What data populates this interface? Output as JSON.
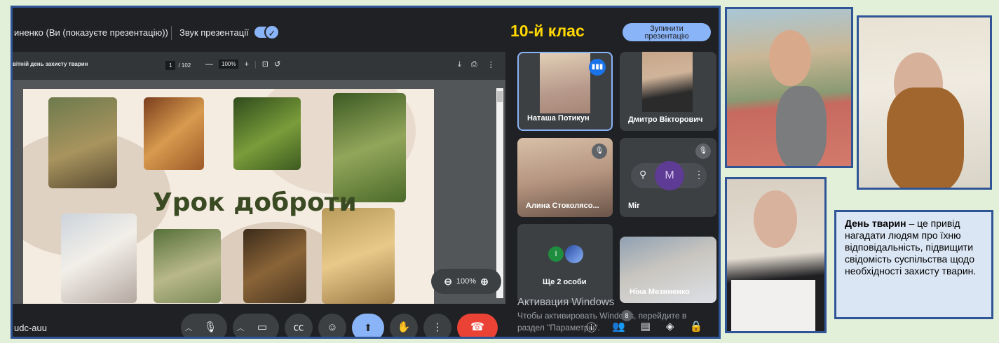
{
  "meet": {
    "presenter_text": "иненко (Ви (показуєте презентацію))",
    "sound_label": "Звук презентації",
    "class_label": "10-й клас",
    "stop_button": "Зупинити\nпрезентацію",
    "pdf": {
      "title": "вітній день захисту тварин",
      "page_current": "1",
      "page_total": "/ 102",
      "zoom": "100%",
      "slide_title": "Урок доброти",
      "zoom_pill": "100%"
    },
    "participants": [
      {
        "name": "Наташа Потикун",
        "speaking": true
      },
      {
        "name": "Дмитро Вікторович"
      },
      {
        "name": "Алина Стоколясо...",
        "muted": true
      },
      {
        "name": "Mir",
        "muted": true,
        "avatar_letter": "M"
      },
      {
        "name": "Ще 2 особи",
        "avatar_letter": "I"
      },
      {
        "name": "Ніна Мезиненко"
      }
    ],
    "meeting_code": "udc-auu",
    "activation_title": "Активация Windows",
    "activation_text": "Чтобы активировать Windows, перейдите в раздел \"Параметры\".",
    "people_count": "8"
  },
  "caption": {
    "bold": "День тварин",
    "text": " – це привід нагадати людям про їхню відповідальність, підвищити свідомість суспільства щодо необхідності захисту тварин."
  },
  "colors": {
    "frame": "#2f5597",
    "background": "#e2efd9",
    "class_label": "#ffd800",
    "accent": "#8ab4f8",
    "end_call": "#ea4335"
  }
}
